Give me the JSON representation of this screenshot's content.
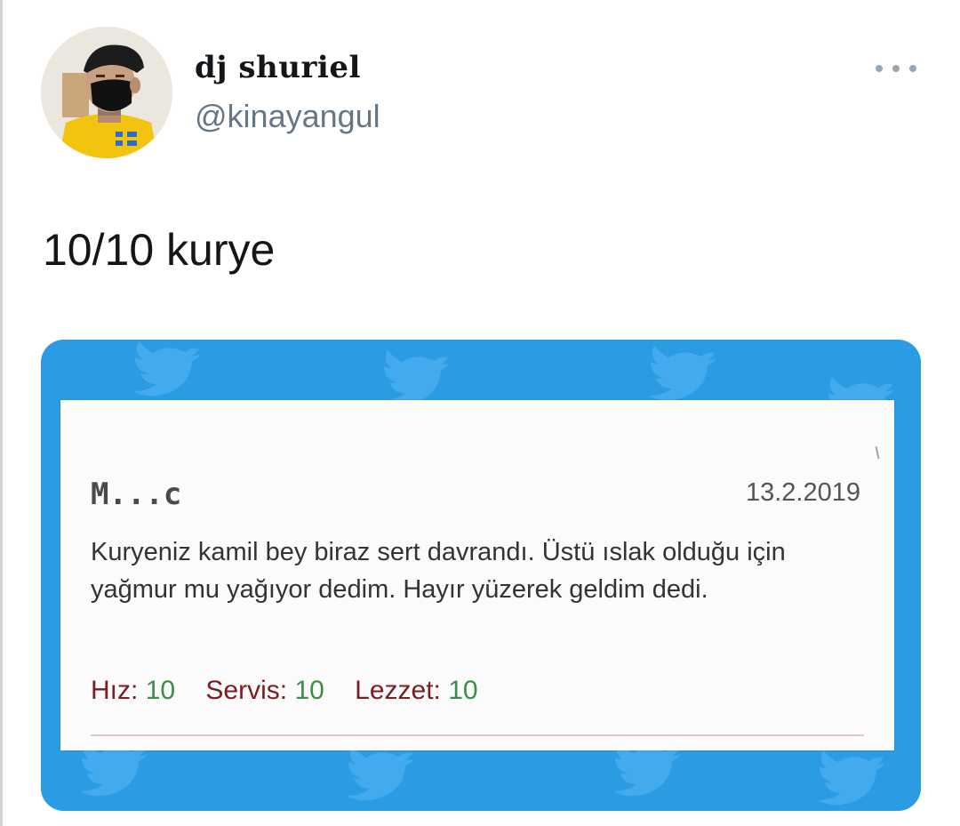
{
  "tweet": {
    "author": {
      "display_name": "dj ꜱhuriel",
      "handle": "@kinayangul",
      "avatar_icon": "avatar-photo-icon"
    },
    "more_icon": "more-dots-icon",
    "text": "10/10 kurye",
    "media": {
      "background_color": "#2b9be3",
      "pattern_icon": "bird-pattern-icon",
      "review": {
        "reviewer": "M...c",
        "date": "13.2.2019",
        "body": "Kuryeniz kamil bey biraz sert davrandı. Üstü ıslak olduğu için yağmur mu yağıyor dedim. Hayır yüzerek geldim dedi.",
        "ratings": [
          {
            "label": "Hız:",
            "value": "10"
          },
          {
            "label": "Servis:",
            "value": "10"
          },
          {
            "label": "Lezzet:",
            "value": "10"
          }
        ],
        "label_color": "#7a1e22",
        "value_color": "#3f8c4a"
      }
    }
  }
}
